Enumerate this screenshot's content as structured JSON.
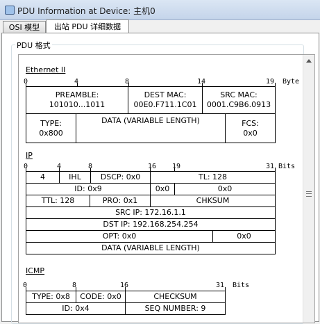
{
  "window": {
    "title": "PDU Information at Device: 主机0"
  },
  "tabs": [
    {
      "label": "OSI 模型"
    },
    {
      "label": "出站 PDU 详细数据"
    }
  ],
  "group": {
    "label": "PDU 格式"
  },
  "ethernet": {
    "title": "Ethernet II",
    "ticks": [
      "0",
      "4",
      "8",
      "14",
      "19"
    ],
    "unit": "Byte",
    "preamble_label": "PREAMBLE:",
    "preamble_value": "101010...1011",
    "dest_mac_label": "DEST MAC:",
    "dest_mac_value": "00E0.F711.1C01",
    "src_mac_label": "SRC MAC:",
    "src_mac_value": "0001.C9B6.0913",
    "type_label": "TYPE:",
    "type_value": "0x800",
    "data": "DATA (VARIABLE LENGTH)",
    "fcs_label": "FCS:",
    "fcs_value": "0x0"
  },
  "ip": {
    "title": "IP",
    "ticks": [
      "0",
      "4",
      "8",
      "16",
      "19",
      "31"
    ],
    "unit": "Bits",
    "version": "4",
    "ihl": "IHL",
    "dscp": "DSCP: 0x0",
    "tl": "TL: 128",
    "id": "ID: 0x9",
    "flags": "0x0",
    "frag_offset": "0x0",
    "ttl": "TTL: 128",
    "pro": "PRO: 0x1",
    "chksum": "CHKSUM",
    "src_ip": "SRC IP: 172.16.1.1",
    "dst_ip": "DST IP: 192.168.254.254",
    "opt": "OPT: 0x0",
    "opt_pad": "0x0",
    "data": "DATA (VARIABLE LENGTH)"
  },
  "icmp": {
    "title": "ICMP",
    "ticks": [
      "0",
      "8",
      "16",
      "31"
    ],
    "unit": "Bits",
    "type": "TYPE: 0x8",
    "code": "CODE: 0x0",
    "checksum": "CHECKSUM",
    "id": "ID: 0x4",
    "seq": "SEQ NUMBER: 9"
  }
}
